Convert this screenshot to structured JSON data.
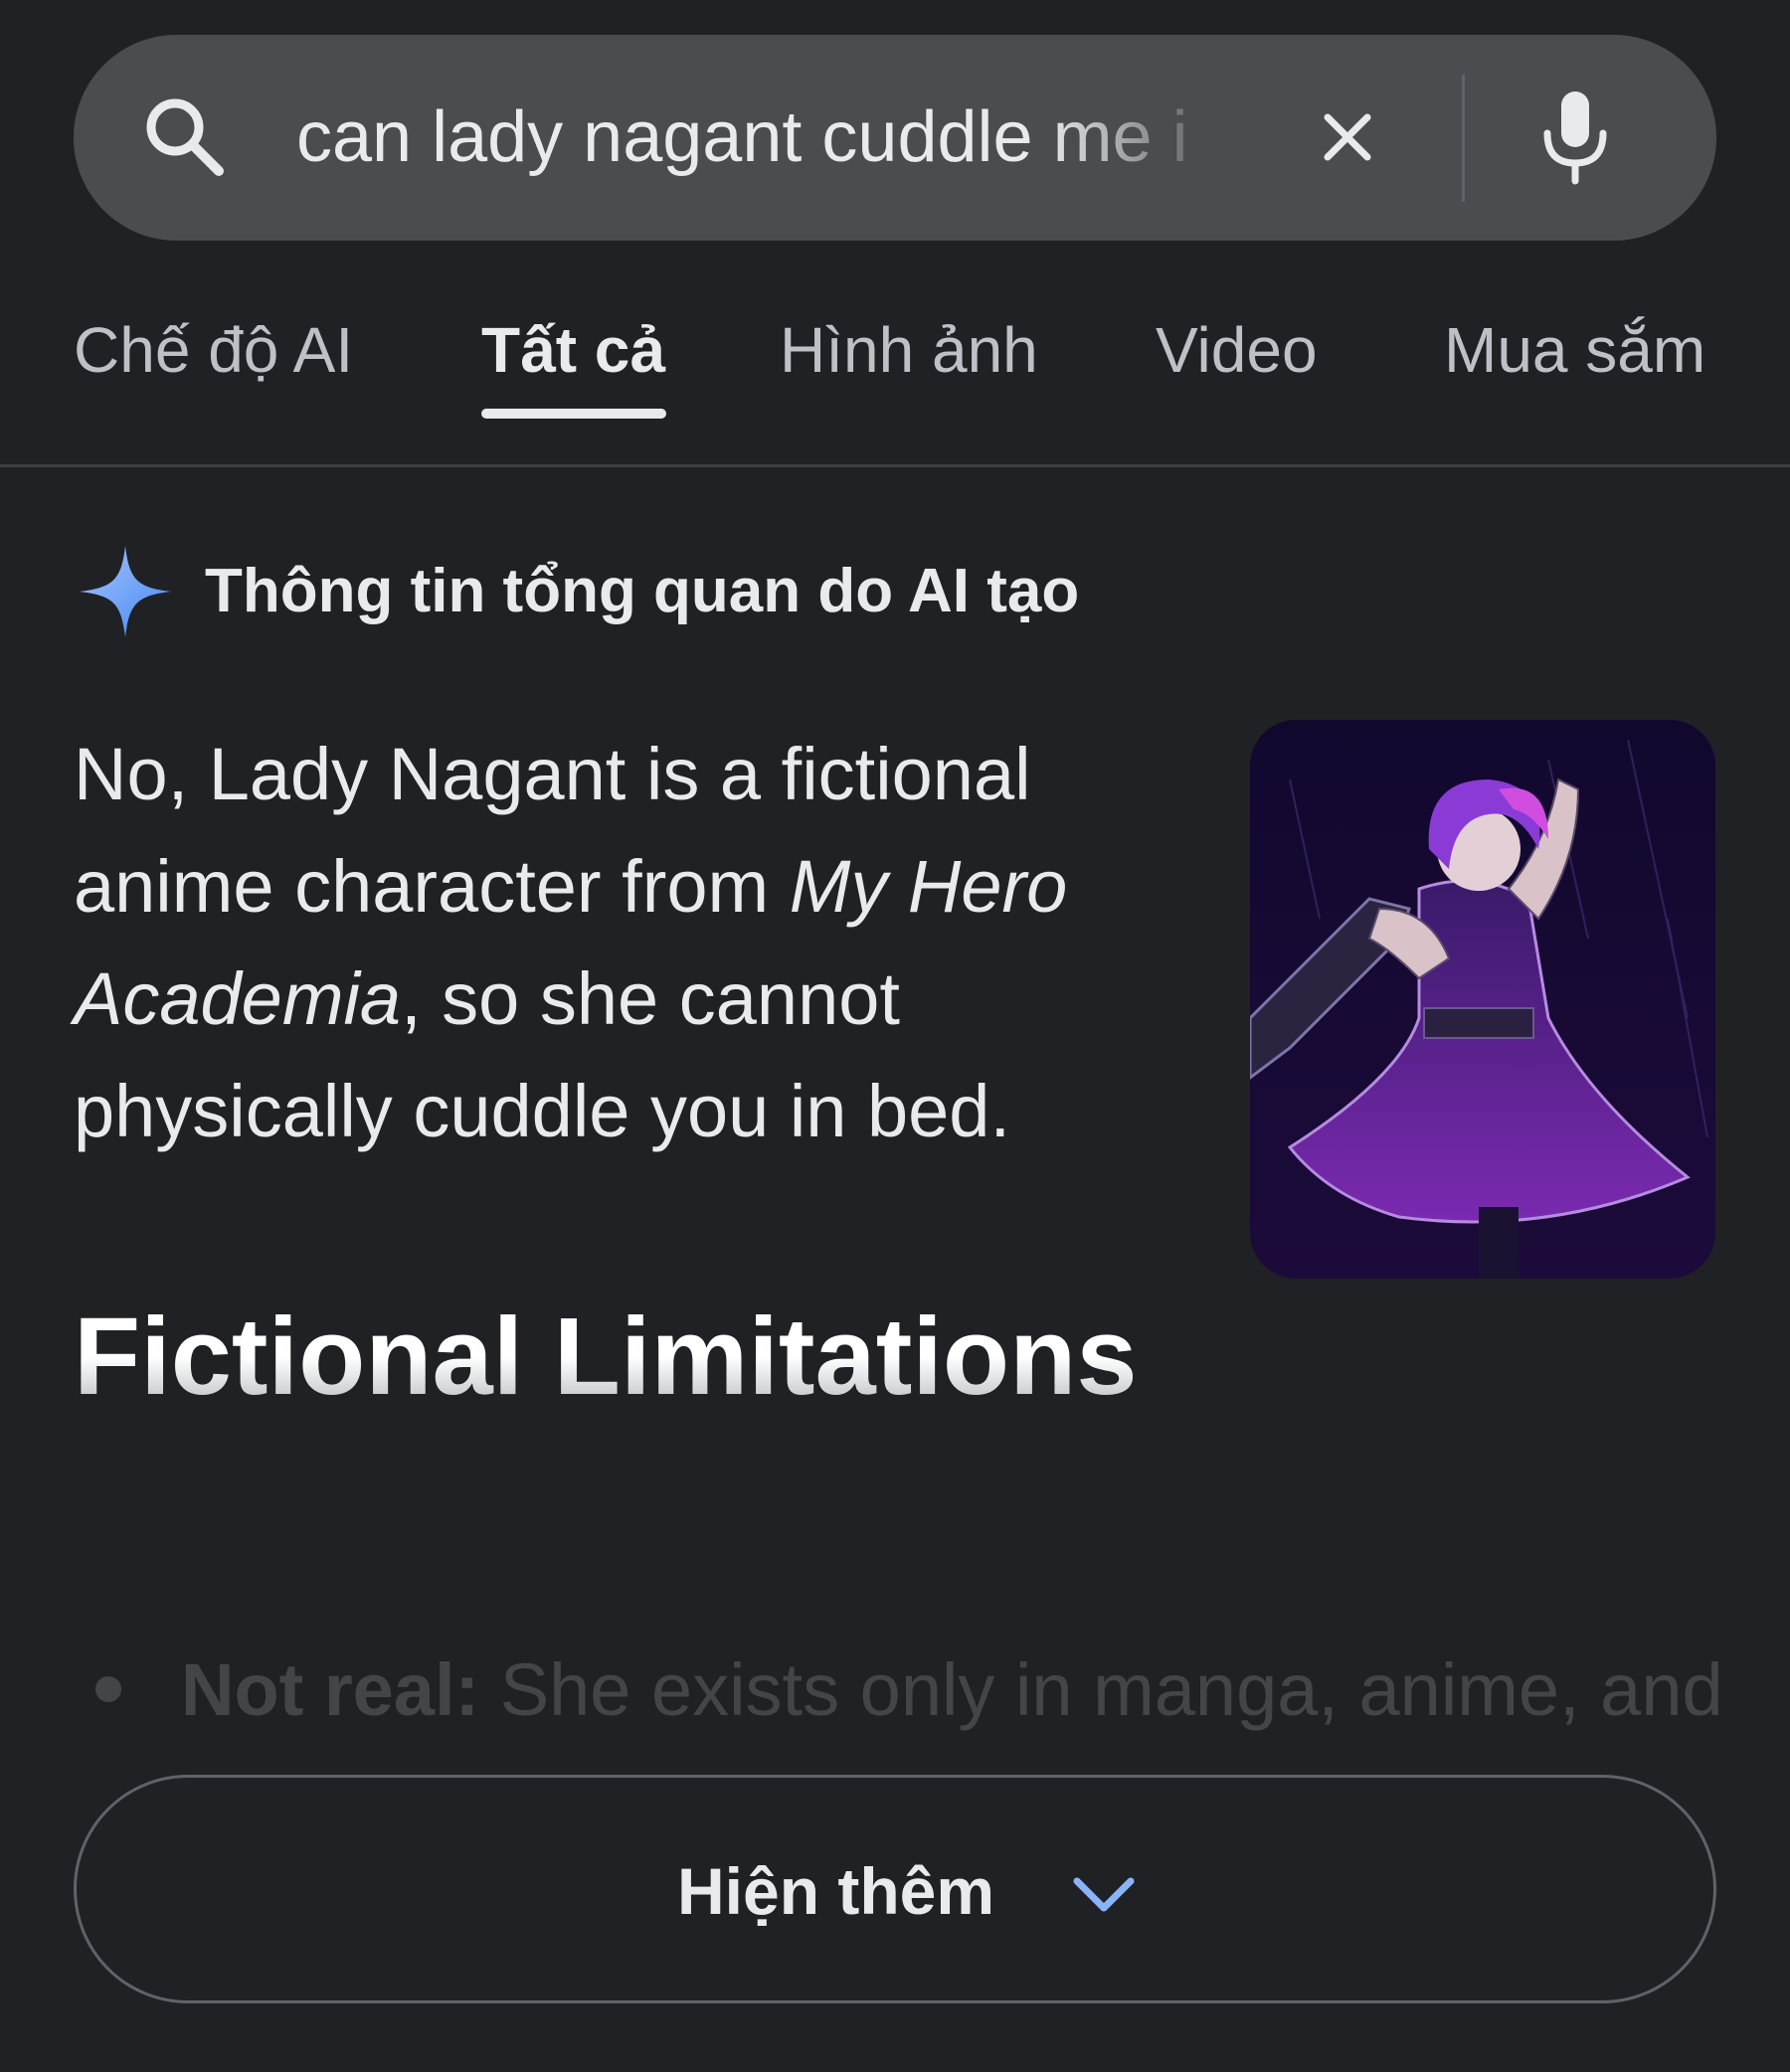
{
  "search": {
    "query": "can lady nagant cuddle me i",
    "icons": {
      "search": "search-icon",
      "clear": "close-icon",
      "voice": "microphone-icon"
    }
  },
  "tabs": [
    {
      "label": "Chế độ AI",
      "active": false
    },
    {
      "label": "Tất cả",
      "active": true
    },
    {
      "label": "Hình ảnh",
      "active": false
    },
    {
      "label": "Video",
      "active": false
    },
    {
      "label": "Mua sắm",
      "active": false
    }
  ],
  "ai_overview": {
    "icon": "sparkle-icon",
    "title": "Thông tin tổng quan do AI tạo",
    "answer": {
      "part1": "No, Lady Nagant is a fictional anime character from ",
      "italic": "My Hero Academia",
      "part2": ", so she cannot physically cuddle you in bed."
    },
    "section_heading": "Fictional Limitations",
    "bullet": {
      "bold": "Not real:",
      "text": " She exists only in manga, anime, and"
    }
  },
  "show_more": {
    "label": "Hiện thêm",
    "icon": "chevron-down-icon"
  },
  "colors": {
    "background": "#202124",
    "search_bar": "#4a4c50",
    "text": "#e8eaed",
    "muted_text": "#bdc1c6",
    "accent_blue": "#8ab4f8"
  }
}
